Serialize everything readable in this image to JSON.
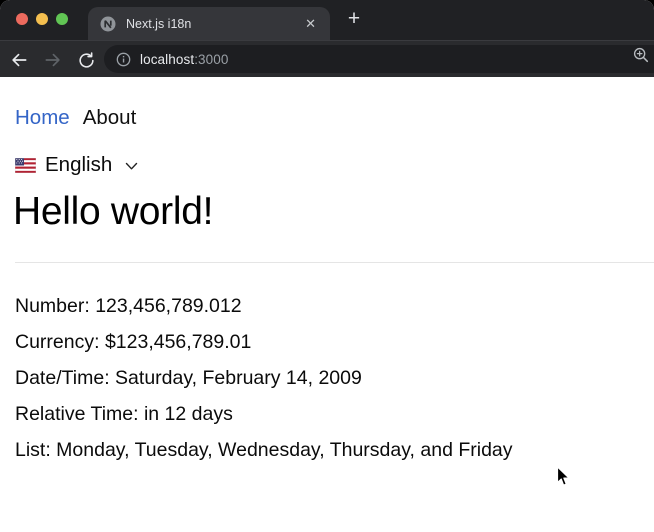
{
  "browser": {
    "traffic_lights": {
      "close": "red",
      "minimize": "yellow",
      "zoom": "green"
    },
    "tab": {
      "title": "Next.js i18n",
      "close_glyph": "✕",
      "favicon": "nextjs-logo-icon"
    },
    "new_tab_glyph": "+",
    "address_bar": {
      "host": "localhost",
      "port": ":3000",
      "leading_icon": "info-icon",
      "trailing_icon": "zoom-magnifier-plus-icon"
    }
  },
  "page": {
    "nav": [
      {
        "label": "Home",
        "active": true
      },
      {
        "label": "About",
        "active": false
      }
    ],
    "language_selector": {
      "flag": "us-flag-icon",
      "label": "English",
      "chevron": "chevron-down-icon"
    },
    "heading": "Hello world!",
    "lines": [
      {
        "text": "Number: 123,456,789.012"
      },
      {
        "text": "Currency: $123,456,789.01"
      },
      {
        "text": "Date/Time: Saturday, February 14, 2009"
      },
      {
        "text": "Relative Time: in 12 days"
      },
      {
        "text": "List: Monday, Tuesday, Wednesday, Thursday, and Friday"
      }
    ]
  },
  "colors": {
    "link_active": "#3465c7",
    "tabstrip_bg": "#202124",
    "tab_bg": "#35363a",
    "toolbar_bg": "#2a2b2e",
    "omnibox_bg": "#1d1e21",
    "chrome_text": "#e8eaed",
    "chrome_muted": "#9aa0a6"
  }
}
